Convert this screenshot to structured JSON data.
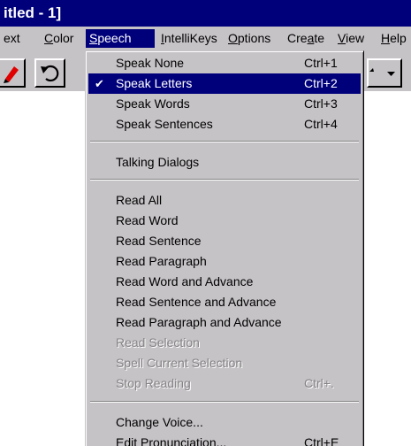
{
  "window": {
    "title": "itled - 1]"
  },
  "menubar": {
    "items": [
      {
        "pre": "",
        "u": "",
        "post": "ext"
      },
      {
        "pre": "",
        "u": "C",
        "post": "olor"
      },
      {
        "pre": "",
        "u": "S",
        "post": "peech"
      },
      {
        "pre": "",
        "u": "I",
        "post": "ntelliKeys"
      },
      {
        "pre": "",
        "u": "O",
        "post": "ptions"
      },
      {
        "pre": "Cre",
        "u": "a",
        "post": "te"
      },
      {
        "pre": "",
        "u": "V",
        "post": "iew"
      },
      {
        "pre": "",
        "u": "H",
        "post": "elp"
      }
    ],
    "active_index": 2
  },
  "speech_menu": {
    "items": [
      {
        "label": "Speak None",
        "shortcut": "Ctrl+1",
        "checked": false,
        "selected": false,
        "disabled": false
      },
      {
        "label": "Speak Letters",
        "shortcut": "Ctrl+2",
        "checked": true,
        "selected": true,
        "disabled": false
      },
      {
        "label": "Speak Words",
        "shortcut": "Ctrl+3",
        "checked": false,
        "selected": false,
        "disabled": false
      },
      {
        "label": "Speak Sentences",
        "shortcut": "Ctrl+4",
        "checked": false,
        "selected": false,
        "disabled": false
      },
      {
        "label": "Talking Dialogs",
        "shortcut": "",
        "checked": false,
        "selected": false,
        "disabled": false
      },
      {
        "label": "Read All",
        "shortcut": "",
        "checked": false,
        "selected": false,
        "disabled": false
      },
      {
        "label": "Read Word",
        "shortcut": "",
        "checked": false,
        "selected": false,
        "disabled": false
      },
      {
        "label": "Read Sentence",
        "shortcut": "",
        "checked": false,
        "selected": false,
        "disabled": false
      },
      {
        "label": "Read Paragraph",
        "shortcut": "",
        "checked": false,
        "selected": false,
        "disabled": false
      },
      {
        "label": "Read Word and Advance",
        "shortcut": "",
        "checked": false,
        "selected": false,
        "disabled": false
      },
      {
        "label": "Read Sentence and Advance",
        "shortcut": "",
        "checked": false,
        "selected": false,
        "disabled": false
      },
      {
        "label": "Read Paragraph and Advance",
        "shortcut": "",
        "checked": false,
        "selected": false,
        "disabled": false
      },
      {
        "label": "Read Selection",
        "shortcut": "",
        "checked": false,
        "selected": false,
        "disabled": true
      },
      {
        "label": "Spell Current Selection",
        "shortcut": "",
        "checked": false,
        "selected": false,
        "disabled": true
      },
      {
        "label": "Stop Reading",
        "shortcut": "Ctrl+.",
        "checked": false,
        "selected": false,
        "disabled": true
      },
      {
        "label": "Change Voice...",
        "shortcut": "",
        "checked": false,
        "selected": false,
        "disabled": false
      },
      {
        "label": "Edit Pronunciation...",
        "shortcut": "Ctrl+E",
        "checked": false,
        "selected": false,
        "disabled": false
      }
    ],
    "check_glyph": "✔"
  },
  "icons": {
    "toolbar": [
      "pencil-icon",
      "undo-icon",
      "dropdown-arrow-icon"
    ]
  },
  "colors": {
    "titlebar": "#00007b",
    "highlight": "#00007b",
    "face": "#c6c3c6",
    "disabled_text": "#848284"
  }
}
